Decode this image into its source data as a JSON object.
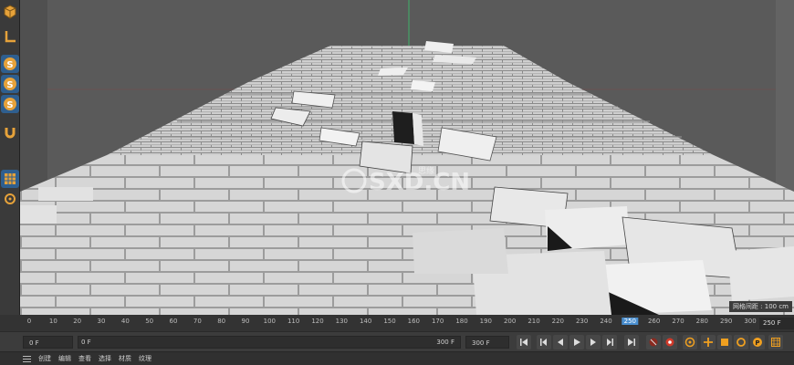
{
  "timeline": {
    "ticks": [
      "0",
      "10",
      "20",
      "30",
      "40",
      "50",
      "60",
      "70",
      "80",
      "90",
      "100",
      "110",
      "120",
      "130",
      "140",
      "150",
      "160",
      "170",
      "180",
      "190",
      "200",
      "210",
      "220",
      "230",
      "240",
      "250",
      "260",
      "270",
      "280",
      "290",
      "300"
    ],
    "current_frame": "250",
    "end_badge": "250 F"
  },
  "viewport": {
    "grid_distance": "网格间距 : 100 cm"
  },
  "transport": {
    "current_field": "0 F",
    "range_start": "0 F",
    "range_end": "300 F",
    "end_field": "300 F"
  },
  "menu": {
    "items": [
      "创建",
      "编辑",
      "查看",
      "选择",
      "材质",
      "纹理"
    ]
  },
  "toolbar": {
    "icons": [
      "cube-icon",
      "floor-icon",
      "spline-icon",
      "sculpt-icon",
      "nurbs-icon",
      "magnet-icon",
      "texture-icon",
      "snap-icon"
    ]
  },
  "watermark": {
    "text": "SXD.CN",
    "subtext": "思缘"
  },
  "colors": {
    "accent": "#f0a020",
    "current_frame": "#4a8fd0",
    "record": "#d03a2a"
  }
}
